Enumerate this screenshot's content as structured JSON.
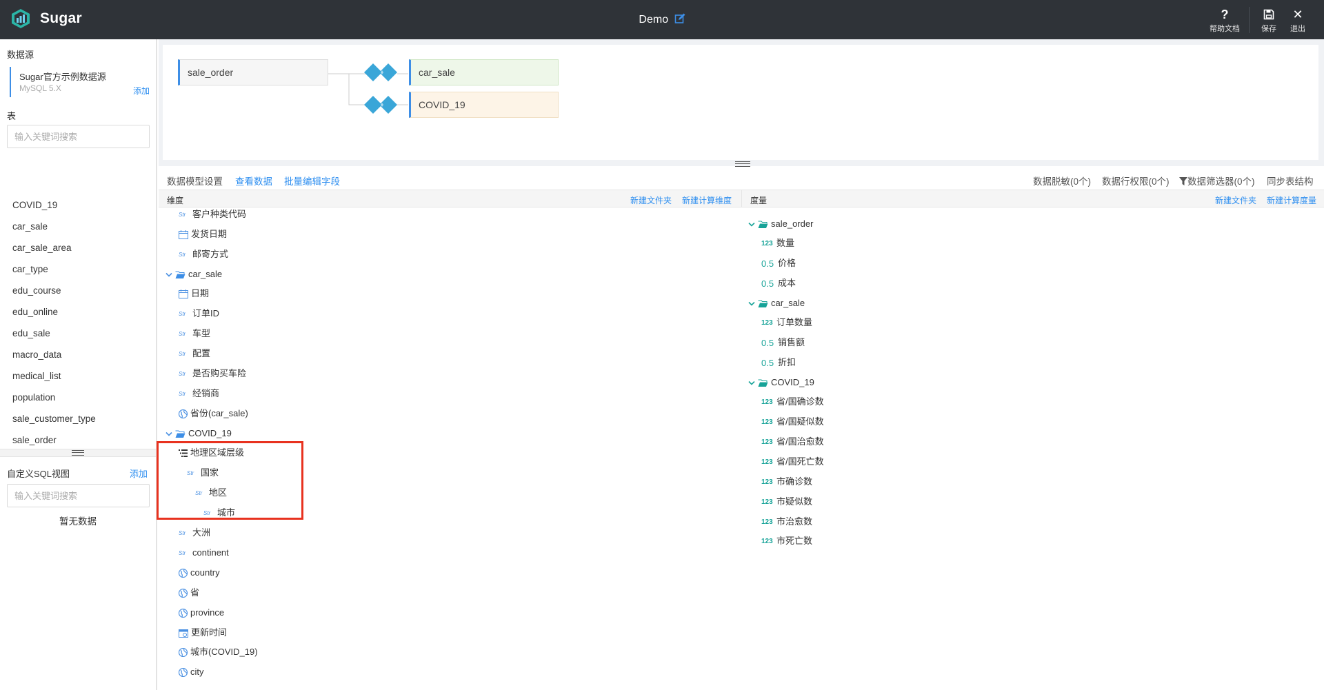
{
  "header": {
    "app_name": "Sugar",
    "title": "Demo",
    "actions": [
      {
        "label": "帮助文档",
        "icon": "question-icon"
      },
      {
        "label": "保存",
        "icon": "save-icon"
      },
      {
        "label": "退出",
        "icon": "close-icon"
      }
    ]
  },
  "sidebar": {
    "datasource_label": "数据源",
    "datasource_name": "Sugar官方示例数据源",
    "datasource_version": "MySQL 5.X",
    "datasource_add": "添加",
    "table_label": "表",
    "table_search_placeholder": "输入关键词搜索",
    "tables": [
      "COVID_19",
      "car_sale",
      "car_sale_area",
      "car_type",
      "edu_course",
      "edu_online",
      "edu_sale",
      "macro_data",
      "medical_list",
      "population",
      "sale_customer_type",
      "sale_order"
    ],
    "sql_view_label": "自定义SQL视图",
    "sql_view_add": "添加",
    "sql_search_placeholder": "输入关键词搜索",
    "sql_empty": "暂无数据"
  },
  "canvas": {
    "nodes": [
      {
        "name": "sale_order"
      },
      {
        "name": "car_sale"
      },
      {
        "name": "COVID_19"
      }
    ]
  },
  "toolbar": {
    "model_settings": "数据模型设置",
    "view_data": "查看数据",
    "batch_edit": "批量编辑字段",
    "masking": "数据脱敏(0个)",
    "row_perm": "数据行权限(0个)",
    "filter": "数据筛选器(0个)",
    "sync": "同步表结构"
  },
  "dimensions": {
    "title": "维度",
    "new_folder": "新建文件夹",
    "new_calc": "新建计算维度",
    "rows": [
      {
        "label": "客户种类代码",
        "type": "Str"
      },
      {
        "label": "发货日期",
        "type": "date"
      },
      {
        "label": "邮寄方式",
        "type": "Str"
      },
      {
        "label": "car_sale",
        "type": "folder"
      },
      {
        "label": "日期",
        "type": "date"
      },
      {
        "label": "订单ID",
        "type": "Str"
      },
      {
        "label": "车型",
        "type": "Str"
      },
      {
        "label": "配置",
        "type": "Str"
      },
      {
        "label": "是否购买车险",
        "type": "Str"
      },
      {
        "label": "经销商",
        "type": "Str"
      },
      {
        "label": "省份(car_sale)",
        "type": "geo"
      },
      {
        "label": "COVID_19",
        "type": "folder"
      },
      {
        "label": "地理区域层级",
        "type": "hierarchy"
      },
      {
        "label": "国家",
        "type": "Str"
      },
      {
        "label": "地区",
        "type": "Str"
      },
      {
        "label": "城市",
        "type": "Str"
      },
      {
        "label": "大洲",
        "type": "Str"
      },
      {
        "label": "continent",
        "type": "Str"
      },
      {
        "label": "country",
        "type": "geo"
      },
      {
        "label": "省",
        "type": "geo"
      },
      {
        "label": "province",
        "type": "geo"
      },
      {
        "label": "更新时间",
        "type": "datetime"
      },
      {
        "label": "城市(COVID_19)",
        "type": "geo"
      },
      {
        "label": "city",
        "type": "geo"
      }
    ]
  },
  "measures": {
    "title": "度量",
    "new_folder": "新建文件夹",
    "new_calc": "新建计算度量",
    "rows": [
      {
        "label": "sale_order",
        "type": "folder"
      },
      {
        "label": "数量",
        "type": "123"
      },
      {
        "label": "价格",
        "type": "0.5"
      },
      {
        "label": "成本",
        "type": "0.5"
      },
      {
        "label": "car_sale",
        "type": "folder"
      },
      {
        "label": "订单数量",
        "type": "123"
      },
      {
        "label": "销售额",
        "type": "0.5"
      },
      {
        "label": "折扣",
        "type": "0.5"
      },
      {
        "label": "COVID_19",
        "type": "folder"
      },
      {
        "label": "省/国确诊数",
        "type": "123"
      },
      {
        "label": "省/国疑似数",
        "type": "123"
      },
      {
        "label": "省/国治愈数",
        "type": "123"
      },
      {
        "label": "省/国死亡数",
        "type": "123"
      },
      {
        "label": "市确诊数",
        "type": "123"
      },
      {
        "label": "市疑似数",
        "type": "123"
      },
      {
        "label": "市治愈数",
        "type": "123"
      },
      {
        "label": "市死亡数",
        "type": "123"
      }
    ]
  },
  "colors": {
    "accent": "#2f8ff0",
    "header_bg": "#2f3338",
    "highlight": "#e8321f",
    "teal": "#17a398"
  }
}
